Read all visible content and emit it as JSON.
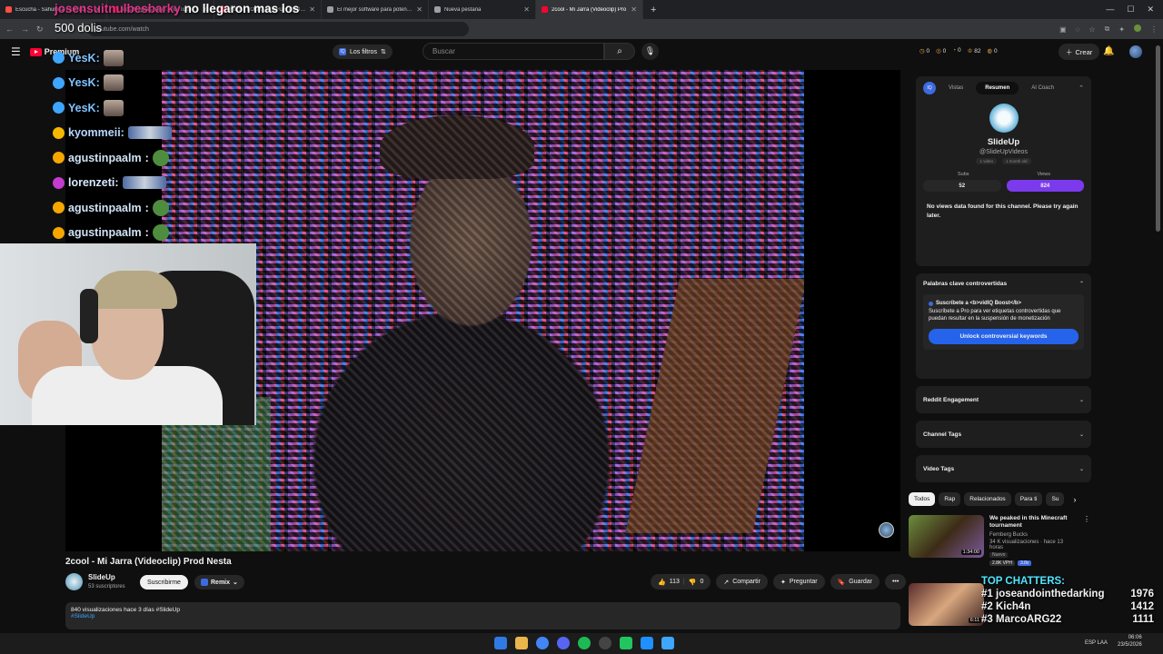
{
  "browser": {
    "tabs": [
      {
        "label": "Escucha - Sahumita | Entrada de voz",
        "color": "#ff4e45",
        "active": false
      },
      {
        "label": "Los Mejores Yeah | YouTube",
        "color": "#ff0033",
        "active": false
      },
      {
        "label": "FIRST LOOK: SULFUR CUBE & G",
        "color": "#ff0033",
        "active": false
      },
      {
        "label": "El mejor software para potencia",
        "color": "#9aa0a6",
        "active": false
      },
      {
        "label": "Nueva pestaña",
        "color": "#9aa0a6",
        "active": false
      },
      {
        "label": "2cool - Mi Jarra (Videoclip) Pro",
        "color": "#ff0033",
        "active": true
      }
    ],
    "new_tab": "+",
    "url": "youtube.com/watch"
  },
  "youtube": {
    "logo_text": "Premium",
    "filters_label": "Los filtros",
    "search_placeholder": "Buscar",
    "header_stats": [
      "0",
      "0",
      "0",
      "82",
      "0"
    ],
    "create_label": "Crear"
  },
  "stream_overlay": {
    "tts_name": "josensuitnulbesbarky",
    "tts_text": "no llegaron mas los",
    "tts_amount": "500 dolis",
    "chat": [
      {
        "user": "YesK:",
        "color": "#7fc4ff",
        "badge_color": "#3ea6ff"
      },
      {
        "user": "YesK:",
        "color": "#7fc4ff",
        "badge_color": "#3ea6ff"
      },
      {
        "user": "YesK:",
        "color": "#7fc4ff",
        "badge_color": "#3ea6ff"
      },
      {
        "user": "kyommeii:",
        "color": "#b8d6ff",
        "badge_color": "#f5b800"
      },
      {
        "user": "agustinpaalm",
        "color": "#d0e3f5",
        "badge_color": "#f5a700",
        "suffix": ":"
      },
      {
        "user": "lorenzeti:",
        "color": "#d9e8ff",
        "badge_color": "#c43ccf"
      },
      {
        "user": "agustinpaalm",
        "color": "#d0e3f5",
        "badge_color": "#f5a700",
        "suffix": ":"
      },
      {
        "user": "agustinpaalm",
        "color": "#d0e3f5",
        "badge_color": "#f5a700",
        "suffix": ":"
      }
    ],
    "top_chatters": {
      "title": "TOP CHATTERS:",
      "rows": [
        {
          "rank": "#1",
          "name": "joseandointhedarking",
          "count": "1976"
        },
        {
          "rank": "#2",
          "name": "Kich4n",
          "count": "1412"
        },
        {
          "rank": "#3",
          "name": "MarcoARG22",
          "count": "1111"
        }
      ]
    }
  },
  "video": {
    "title": "2cool - Mi Jarra (Videoclip) Prod Nesta",
    "channel": "SlideUp",
    "subscribers": "53 suscriptores",
    "subscribe_label": "Suscribirme",
    "remix_label": "Remix",
    "likes": "113",
    "dislikes": "0",
    "share_label": "Compartir",
    "ask_label": "Preguntar",
    "save_label": "Guardar",
    "more_label": "•••",
    "description_meta": "840 visualizaciones  hace 3 días  #SlideUp",
    "description_tag": "#SlideUp"
  },
  "vidiq": {
    "logo": "IQ",
    "tabs": [
      "Vistas",
      "Resumen",
      "AI Coach"
    ],
    "active_tab": "Resumen",
    "channel_name": "SlideUp",
    "channel_handle": "@SlideUpVideos",
    "meta": [
      "1 video",
      "1 month old"
    ],
    "subs_label": "Subs",
    "views_label": "Views",
    "subs_value": "52",
    "views_value": "824",
    "no_data_text": "No views data found for this channel. Please try again later.",
    "keywords_title": "Palabras clave controvertidas",
    "keywords_promo_title": "Suscríbete a <b>vidIQ Boost</b>",
    "keywords_promo_body": "Suscríbete a Pro para ver etiquetas controvertidas que puedan resultar en la suspensión de monetización",
    "unlock_label": "Unlock controversial keywords",
    "sections": [
      "Reddit Engagement",
      "Channel Tags",
      "Video Tags"
    ]
  },
  "related": {
    "chips": [
      "Todos",
      "Rap",
      "Relacionados",
      "Para ti",
      "Su"
    ],
    "items": [
      {
        "title": "We peaked in this Minecraft tournament",
        "channel": "Femberg Bucks",
        "meta": "34 K visualizaciones · hace 13 horas",
        "badge": "Nuevo",
        "duration": "1:34:00",
        "vph": "2.8K VPH",
        "score": "3.8x"
      },
      {
        "duration": "6:11"
      }
    ]
  },
  "taskbar": {
    "lang": "ESP LAA",
    "time": "06:06",
    "date": "23/5/2026"
  }
}
